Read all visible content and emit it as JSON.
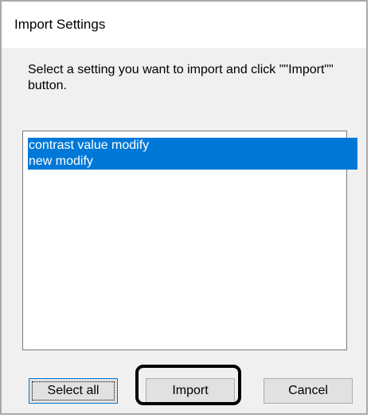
{
  "dialog": {
    "title": "Import Settings",
    "instruction": "Select a setting you want to import and click \"\"Import\"\" button."
  },
  "settings_list": {
    "items": [
      {
        "label": "contrast value modify",
        "selected": true
      },
      {
        "label": "new modify",
        "selected": true
      }
    ]
  },
  "buttons": {
    "select_all": "Select all",
    "import": "Import",
    "cancel": "Cancel"
  },
  "colors": {
    "selection": "#0078d7",
    "dialog_background": "#f0f0f0",
    "button_face": "#e1e1e1",
    "annotation_ring": "#000000"
  }
}
